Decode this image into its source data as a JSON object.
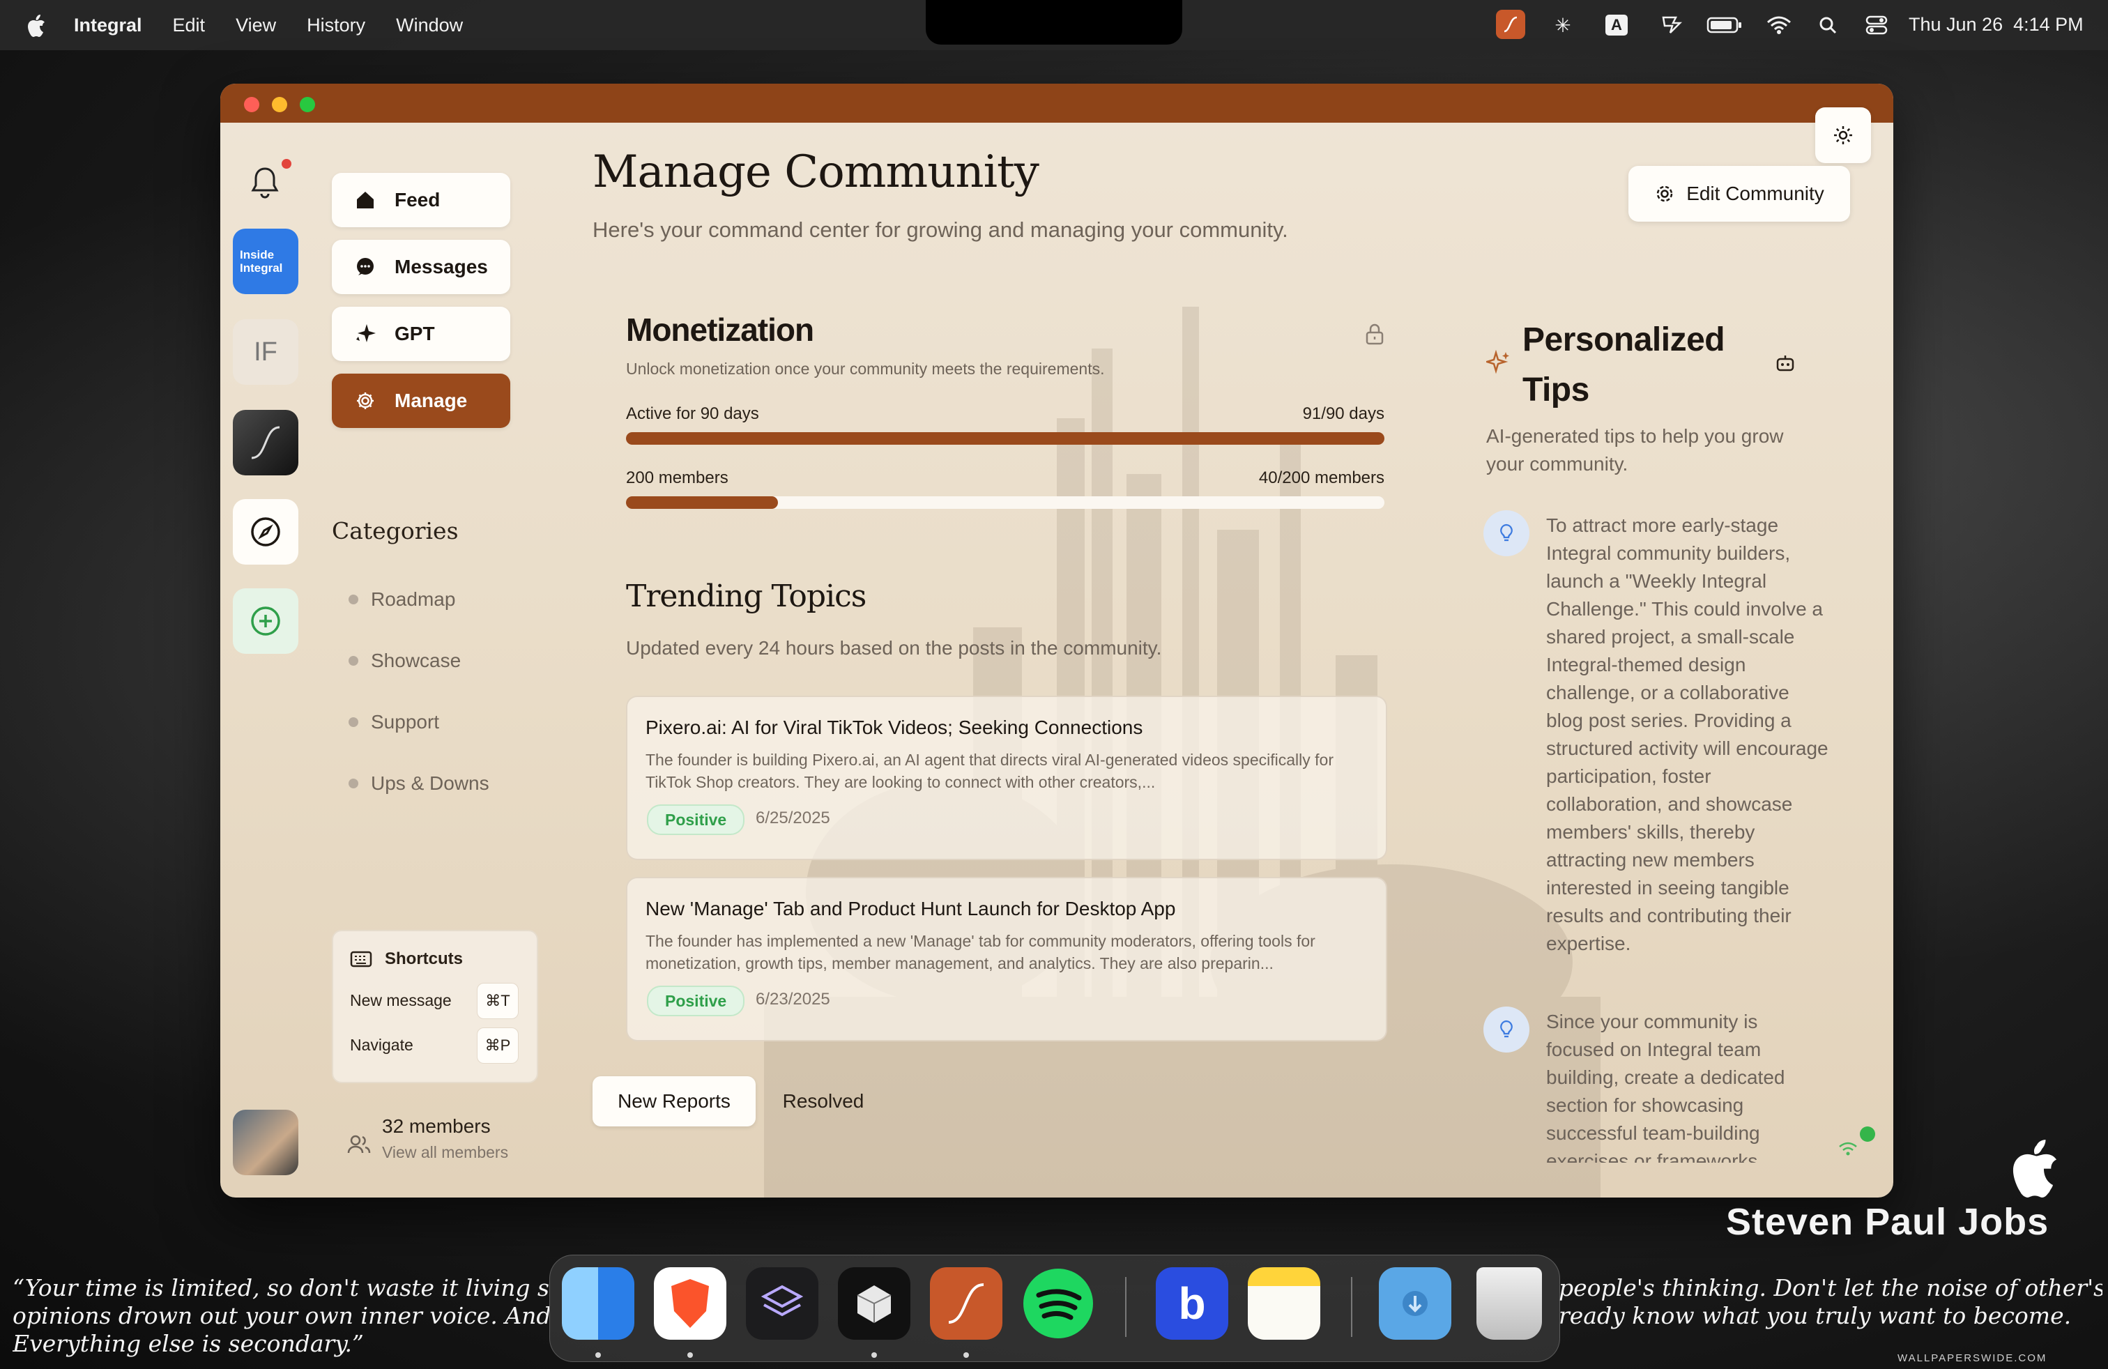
{
  "menubar": {
    "app_name": "Integral",
    "menus": [
      "Edit",
      "View",
      "History",
      "Window"
    ],
    "datetime": "Thu Jun 26  4:14 PM",
    "input_source": "A"
  },
  "rail": {
    "workspace_inside": "Inside Integral",
    "workspace_if": "IF"
  },
  "nav": {
    "feed": "Feed",
    "messages": "Messages",
    "gpt": "GPT",
    "manage": "Manage"
  },
  "categories": {
    "heading": "Categories",
    "items": [
      "Roadmap",
      "Showcase",
      "Support",
      "Ups & Downs"
    ]
  },
  "shortcuts": {
    "heading": "Shortcuts",
    "items": [
      {
        "label": "New message",
        "key": "⌘T"
      },
      {
        "label": "Navigate",
        "key": "⌘P"
      }
    ]
  },
  "members": {
    "count": "32 members",
    "link": "View all members"
  },
  "header": {
    "title": "Manage Community",
    "subtitle": "Here's your command center for growing and managing your community.",
    "edit_button": "Edit Community"
  },
  "monetization": {
    "title": "Monetization",
    "subtitle": "Unlock monetization once your community meets the requirements.",
    "requirements": [
      {
        "label": "Active for 90 days",
        "value": "91/90 days",
        "progress": 1.0
      },
      {
        "label": "200 members",
        "value": "40/200 members",
        "progress": 0.2
      }
    ]
  },
  "trending": {
    "title": "Trending Topics",
    "subtitle": "Updated every 24 hours based on the posts in the community.",
    "topics": [
      {
        "title": "Pixero.ai: AI for Viral TikTok Videos; Seeking Connections",
        "description": "The founder is building Pixero.ai, an AI agent that directs viral AI-generated videos specifically for TikTok Shop creators. They are looking to connect with other creators,...",
        "sentiment": "Positive",
        "date": "6/25/2025"
      },
      {
        "title": "New 'Manage' Tab and Product Hunt Launch for Desktop App",
        "description": "The founder has implemented a new 'Manage' tab for community moderators, offering tools for monetization, growth tips, member management, and analytics. They are also preparin...",
        "sentiment": "Positive",
        "date": "6/23/2025"
      }
    ]
  },
  "reports": {
    "tabs": [
      "New Reports",
      "Resolved"
    ]
  },
  "tips": {
    "title": "Personalized Tips",
    "subtitle": "AI-generated tips to help you grow your community.",
    "items": [
      "To attract more early-stage Integral community builders, launch a \"Weekly Integral Challenge.\" This could involve a shared project, a small-scale Integral-themed design challenge, or a collaborative blog post series. Providing a structured activity will encourage participation, foster collaboration, and showcase members' skills, thereby attracting new members interested in seeing tangible results and contributing their expertise.",
      "Since your community is focused on Integral team building, create a dedicated section for showcasing successful team-building exercises or frameworks"
    ]
  },
  "wallpaper": {
    "name": "Steven Paul Jobs",
    "quote_left": "“Your time is limited, so don't waste it living so",
    "quote_left_2": "opinions drown out your own inner voice. And",
    "quote_left_3": "Everything else is secondary.”",
    "quote_right": "people's thinking. Don't let the noise of other's",
    "quote_right_2": "ready know what you truly want to become.",
    "watermark": "WALLPAPERSWIDE.COM"
  },
  "colors": {
    "accent": "#9a4a1c",
    "titlebar": "#8e4418",
    "positive": "#2f9f4a",
    "notification_dot": "#e2453c"
  },
  "icons": [
    "apple-logo-icon",
    "bell-icon",
    "home-icon",
    "chat-bubble-icon",
    "sparkle-icon",
    "gear-icon",
    "compass-icon",
    "plus-circle-icon",
    "lock-icon",
    "keyboard-icon",
    "users-icon",
    "lightbulb-icon",
    "bot-icon",
    "sun-icon",
    "wifi-icon",
    "search-icon",
    "battery-icon"
  ]
}
